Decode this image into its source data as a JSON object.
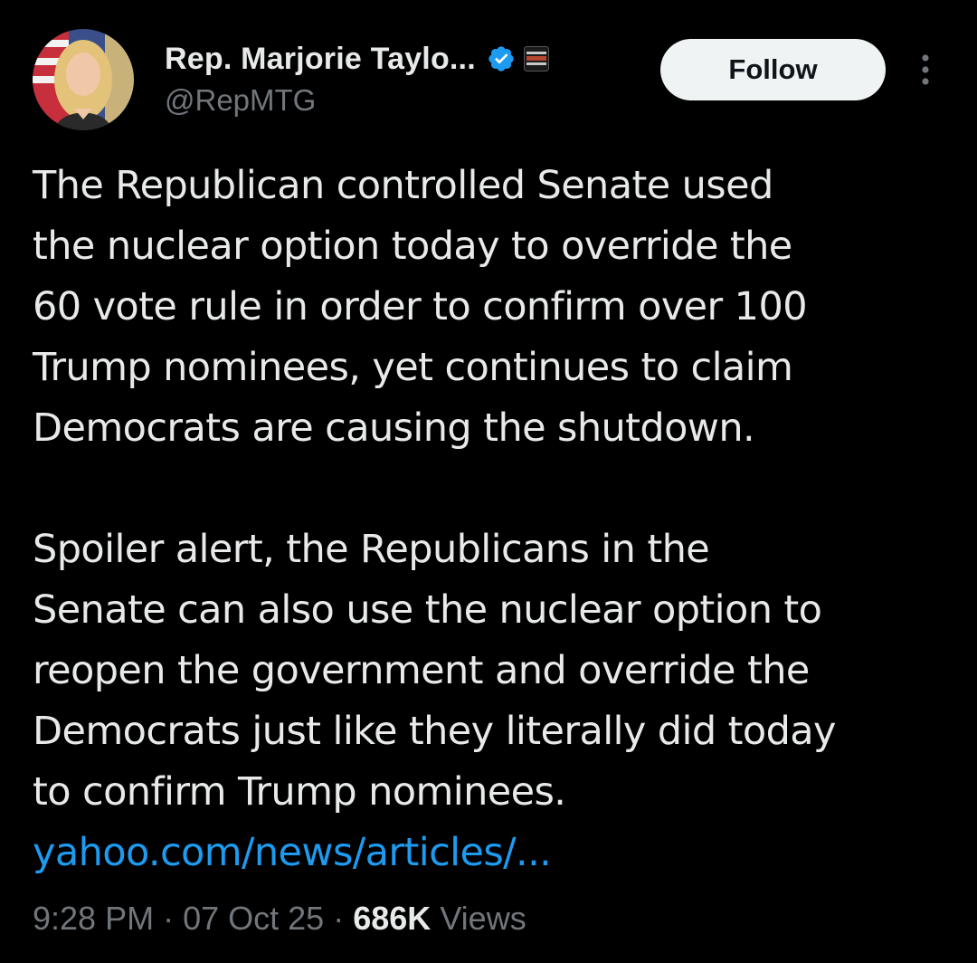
{
  "author": {
    "display_name": "Rep. Marjorie Taylo...",
    "handle": "@RepMTG",
    "verified_icon": "verified-badge-icon",
    "affiliate_icon": "affiliate-badge-icon"
  },
  "actions": {
    "follow_label": "Follow",
    "more_icon": "more-options-icon"
  },
  "tweet": {
    "paragraph_1_lines": [
      "The Republican controlled Senate used",
      "the nuclear option today to override the",
      "60 vote rule in order to confirm over 100",
      "Trump nominees, yet continues to claim",
      "Democrats are causing the shutdown."
    ],
    "paragraph_2_lines": [
      "Spoiler alert, the Republicans in the",
      "Senate can also use the nuclear option to",
      "reopen the government and override the",
      "Democrats just like they literally did today",
      "to confirm Trump nominees."
    ],
    "link_text": "yahoo.com/news/articles/..."
  },
  "meta": {
    "time": "9:28 PM",
    "separator": "·",
    "date": "07 Oct 25",
    "views_count": "686K",
    "views_label": "Views"
  },
  "colors": {
    "background": "#000000",
    "text": "#e7e9ea",
    "muted": "#71767b",
    "link": "#1d9bf0",
    "verified": "#1d9bf0"
  }
}
